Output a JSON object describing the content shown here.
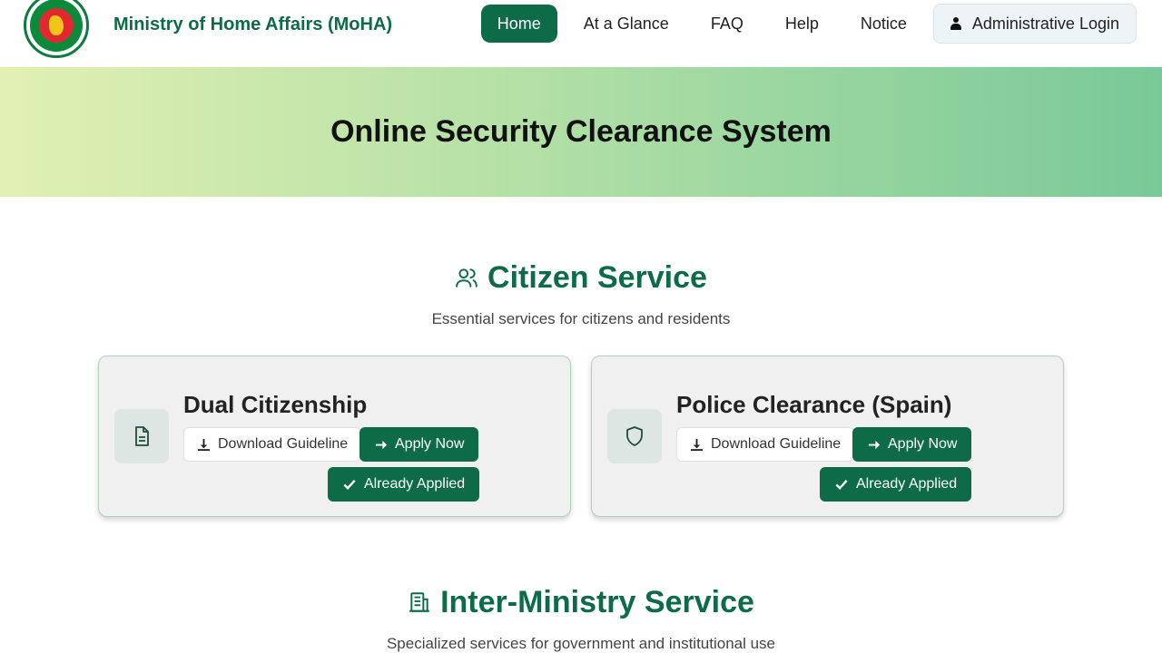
{
  "header": {
    "brand": "Ministry of Home Affairs (MoHA)",
    "nav": [
      "Home",
      "At a Glance",
      "FAQ",
      "Help",
      "Notice"
    ],
    "login_label": "Administrative Login"
  },
  "hero": {
    "title": "Online Security Clearance System"
  },
  "citizen": {
    "title": "Citizen Service",
    "subtitle": "Essential services for citizens and residents",
    "cards": [
      {
        "title": "Dual Citizenship",
        "guideline": "Download Guideline",
        "apply": "Apply Now",
        "applied": "Already Applied",
        "icon": "document-icon"
      },
      {
        "title": "Police Clearance (Spain)",
        "guideline": "Download Guideline",
        "apply": "Apply Now",
        "applied": "Already Applied",
        "icon": "shield-icon"
      }
    ]
  },
  "inter": {
    "title": "Inter-Ministry Service",
    "subtitle": "Specialized services for government and institutional use"
  },
  "colors": {
    "primary": "#0d6b47",
    "hero_start": "#e2f0b3",
    "hero_end": "#79c998",
    "card_bg": "#f0f0f0"
  }
}
